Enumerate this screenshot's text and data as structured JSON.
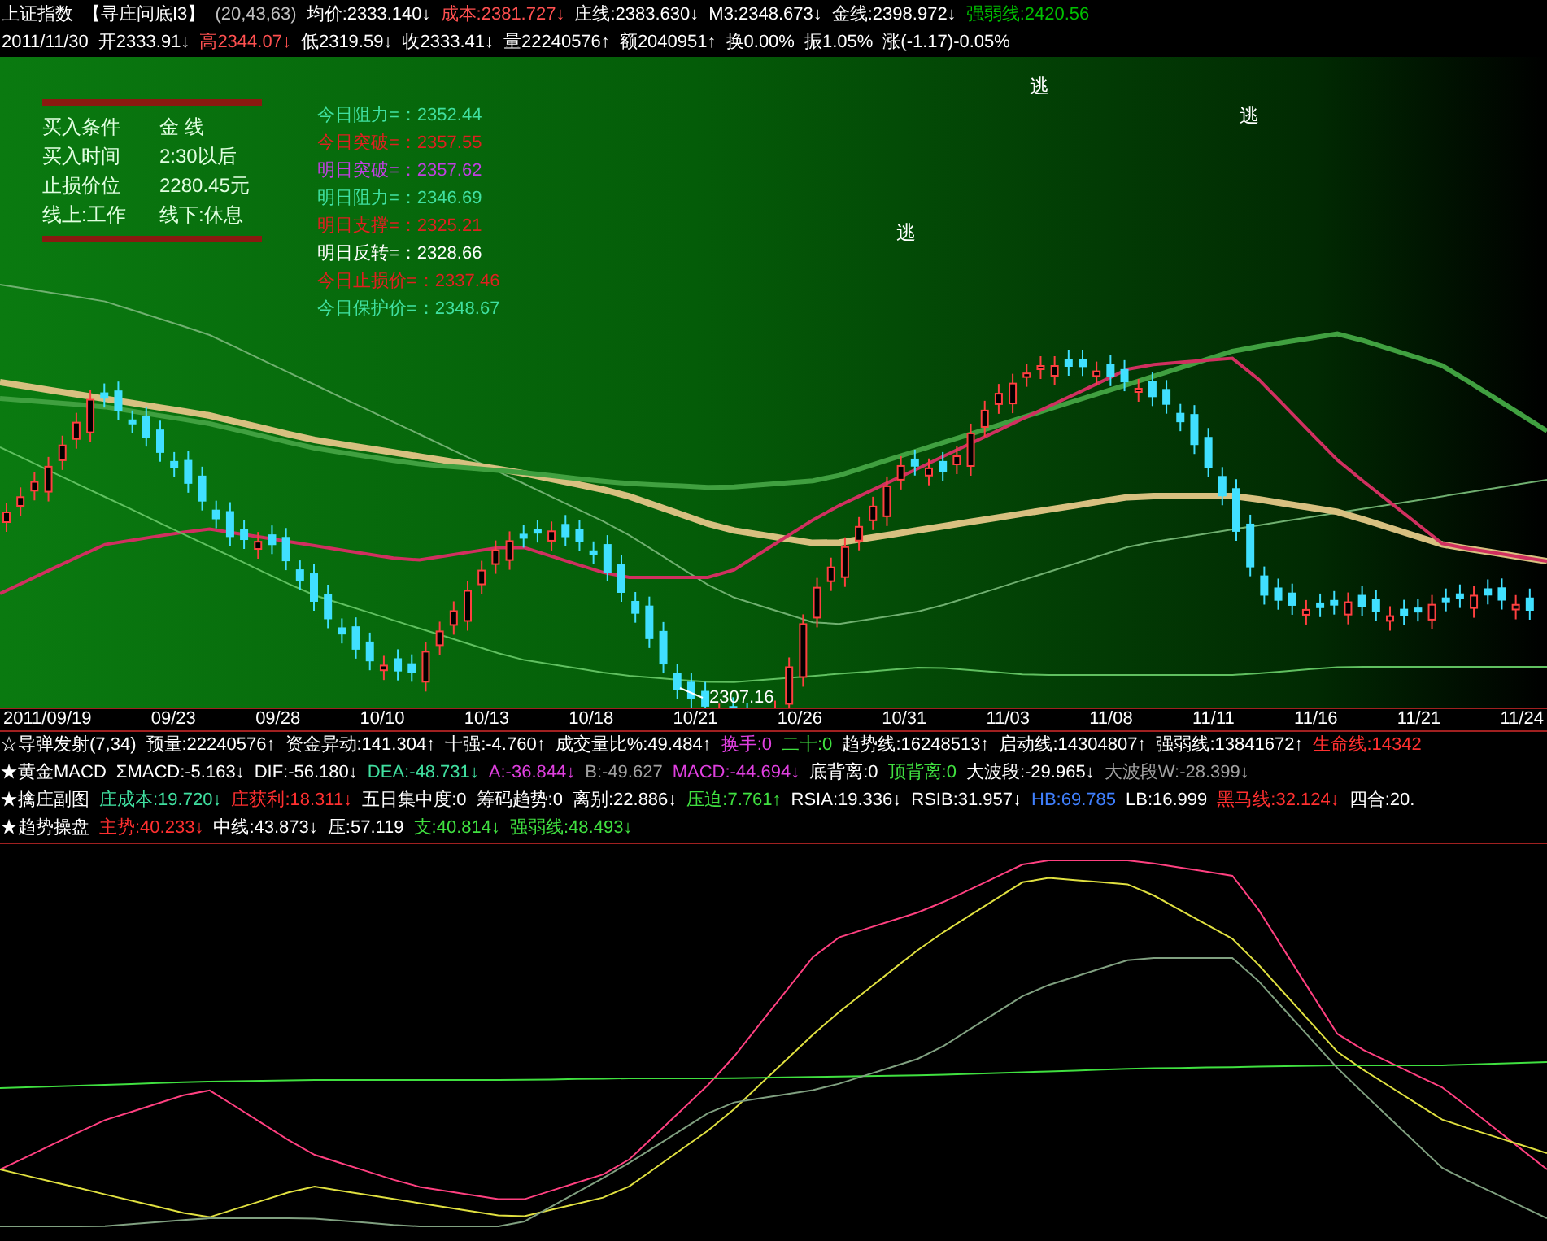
{
  "header": {
    "line1": [
      {
        "text": "上证指数",
        "color": "#ffffff"
      },
      {
        "text": "【寻庄问底I3】",
        "color": "#ffffff"
      },
      {
        "text": "(20,43,63)",
        "color": "#c0c0c0"
      },
      {
        "text": "均价:2333.140↓",
        "color": "#ffffff"
      },
      {
        "text": "成本:2381.727↓",
        "color": "#ff5050"
      },
      {
        "text": "庄线:2383.630↓",
        "color": "#ffffff"
      },
      {
        "text": "M3:2348.673↓",
        "color": "#ffffff"
      },
      {
        "text": "金线:2398.972↓",
        "color": "#ffffff"
      },
      {
        "text": "强弱线:2420.56",
        "color": "#00c000"
      }
    ],
    "line2": [
      {
        "text": "2011/11/30",
        "color": "#ffffff"
      },
      {
        "text": "开2333.91↓",
        "color": "#ffffff"
      },
      {
        "text": "高2344.07↓",
        "color": "#ff5050"
      },
      {
        "text": "低2319.59↓",
        "color": "#ffffff"
      },
      {
        "text": "收2333.41↓",
        "color": "#ffffff"
      },
      {
        "text": "量22240576↑",
        "color": "#ffffff"
      },
      {
        "text": "额2040951↑",
        "color": "#ffffff"
      },
      {
        "text": "换0.00%",
        "color": "#ffffff"
      },
      {
        "text": "振1.05%",
        "color": "#ffffff"
      },
      {
        "text": "涨(-1.17)-0.05%",
        "color": "#ffffff"
      }
    ]
  },
  "buy_panel": [
    {
      "label": "买入条件",
      "value": "金  线"
    },
    {
      "label": "买入时间",
      "value": "2:30以后"
    },
    {
      "label": "止损价位",
      "value": "2280.45元"
    },
    {
      "label": "线上:工作",
      "value": "线下:休息"
    }
  ],
  "levels": [
    {
      "text": "今日阻力=：2352.44",
      "color": "#40e0a0"
    },
    {
      "text": "今日突破=：2357.55",
      "color": "#e02020"
    },
    {
      "text": "明日突破=：2357.62",
      "color": "#c040e0"
    },
    {
      "text": "明日阻力=：2346.69",
      "color": "#40e0a0"
    },
    {
      "text": "明日支撑=：2325.21",
      "color": "#e02020"
    },
    {
      "text": "明日反转=：2328.66",
      "color": "#ffffff"
    },
    {
      "text": "今日止损价=：2337.46",
      "color": "#e02020"
    },
    {
      "text": "今日保护价=：2348.67",
      "color": "#40e0a0"
    }
  ],
  "signals": [
    {
      "text": "逃"
    },
    {
      "text": "逃"
    },
    {
      "text": "逃"
    }
  ],
  "low_label": "2307.16",
  "dates": [
    "2011/09/19",
    "09/23",
    "09/28",
    "10/10",
    "10/13",
    "10/18",
    "10/21",
    "10/26",
    "10/31",
    "11/03",
    "11/08",
    "11/11",
    "11/16",
    "11/21",
    "11/24"
  ],
  "indicator_rows": [
    [
      {
        "text": "☆导弹发射(7,34)",
        "color": "#ffffff"
      },
      {
        "text": "预量:22240576↑",
        "color": "#ffffff"
      },
      {
        "text": "资金异动:141.304↑",
        "color": "#ffffff"
      },
      {
        "text": "十强:-4.760↑",
        "color": "#ffffff"
      },
      {
        "text": "成交量比%:49.484↑",
        "color": "#ffffff"
      },
      {
        "text": "换手:0",
        "color": "#e040e0"
      },
      {
        "text": "二十:0",
        "color": "#40e040"
      },
      {
        "text": "趋势线:16248513↑",
        "color": "#ffffff"
      },
      {
        "text": "启动线:14304807↑",
        "color": "#ffffff"
      },
      {
        "text": "强弱线:13841672↑",
        "color": "#ffffff"
      },
      {
        "text": "生命线:14342",
        "color": "#ff3030"
      }
    ],
    [
      {
        "text": "★黄金MACD",
        "color": "#ffffff"
      },
      {
        "text": "ΣMACD:-5.163↓",
        "color": "#ffffff"
      },
      {
        "text": "DIF:-56.180↓",
        "color": "#ffffff"
      },
      {
        "text": "DEA:-48.731↓",
        "color": "#40e0a0"
      },
      {
        "text": "A:-36.844↓",
        "color": "#e040e0"
      },
      {
        "text": "B:-49.627",
        "color": "#a0a0a0"
      },
      {
        "text": "MACD:-44.694↓",
        "color": "#e040e0"
      },
      {
        "text": "底背离:0",
        "color": "#ffffff"
      },
      {
        "text": "顶背离:0",
        "color": "#40e040"
      },
      {
        "text": "大波段:-29.965↓",
        "color": "#ffffff"
      },
      {
        "text": "大波段W:-28.399↓",
        "color": "#a0a0a0"
      }
    ],
    [
      {
        "text": "★擒庄副图",
        "color": "#ffffff"
      },
      {
        "text": "庄成本:19.720↓",
        "color": "#40e0a0"
      },
      {
        "text": "庄获利:18.311↓",
        "color": "#ff3030"
      },
      {
        "text": "五日集中度:0",
        "color": "#ffffff"
      },
      {
        "text": "筹码趋势:0",
        "color": "#ffffff"
      },
      {
        "text": "离别:22.886↓",
        "color": "#ffffff"
      },
      {
        "text": "压迫:7.761↑",
        "color": "#40e040"
      },
      {
        "text": "RSIA:19.336↓",
        "color": "#ffffff"
      },
      {
        "text": "RSIB:31.957↓",
        "color": "#ffffff"
      },
      {
        "text": "HB:69.785",
        "color": "#4080ff"
      },
      {
        "text": "LB:16.999",
        "color": "#ffffff"
      },
      {
        "text": "黑马线:32.124↓",
        "color": "#ff3030"
      },
      {
        "text": "四合:20.",
        "color": "#ffffff"
      }
    ],
    [
      {
        "text": "★趋势操盘",
        "color": "#ffffff"
      },
      {
        "text": "主势:40.233↓",
        "color": "#ff3030"
      },
      {
        "text": "中线:43.873↓",
        "color": "#ffffff"
      },
      {
        "text": "压:57.119",
        "color": "#ffffff"
      },
      {
        "text": "支:40.814↓",
        "color": "#40e040"
      },
      {
        "text": "强弱线:48.493↓",
        "color": "#40e040"
      }
    ]
  ]
}
